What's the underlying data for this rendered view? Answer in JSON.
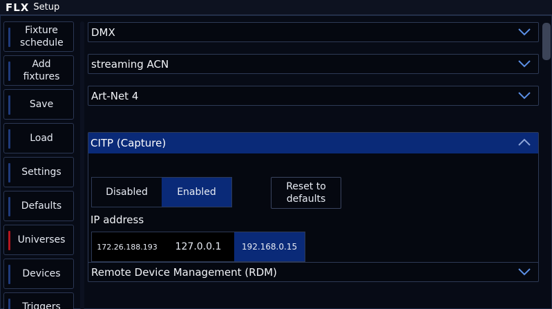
{
  "window": {
    "logo": "FLX",
    "title": "Setup"
  },
  "sidebar": {
    "items": [
      {
        "label": "Fixture schedule",
        "active": false
      },
      {
        "label": "Add fixtures",
        "active": false
      },
      {
        "label": "Save",
        "active": false
      },
      {
        "label": "Load",
        "active": false
      },
      {
        "label": "Settings",
        "active": false
      },
      {
        "label": "Defaults",
        "active": false
      },
      {
        "label": "Universes",
        "active": true
      },
      {
        "label": "Devices",
        "active": false
      },
      {
        "label": "Triggers",
        "active": false
      }
    ]
  },
  "sections": {
    "dmx": "DMX",
    "sacn": "streaming ACN",
    "artnet": "Art-Net 4",
    "citp": "CITP (Capture)",
    "rdm": "Remote Device Management (RDM)"
  },
  "citp": {
    "disabled_label": "Disabled",
    "enabled_label": "Enabled",
    "selected": "Enabled",
    "reset_label": "Reset to defaults",
    "ip_label": "IP address",
    "ip_options": [
      "172.26.188.193",
      "127.0.0.1",
      "192.168.0.15"
    ],
    "ip_selected": "192.168.0.15"
  },
  "colors": {
    "accent": "#0a2a78",
    "active_marker": "#b3161f",
    "marker": "#1f3a7a",
    "background": "#050810"
  },
  "icons": {
    "expand": "chevron-down-icon",
    "collapse": "chevron-up-icon"
  }
}
